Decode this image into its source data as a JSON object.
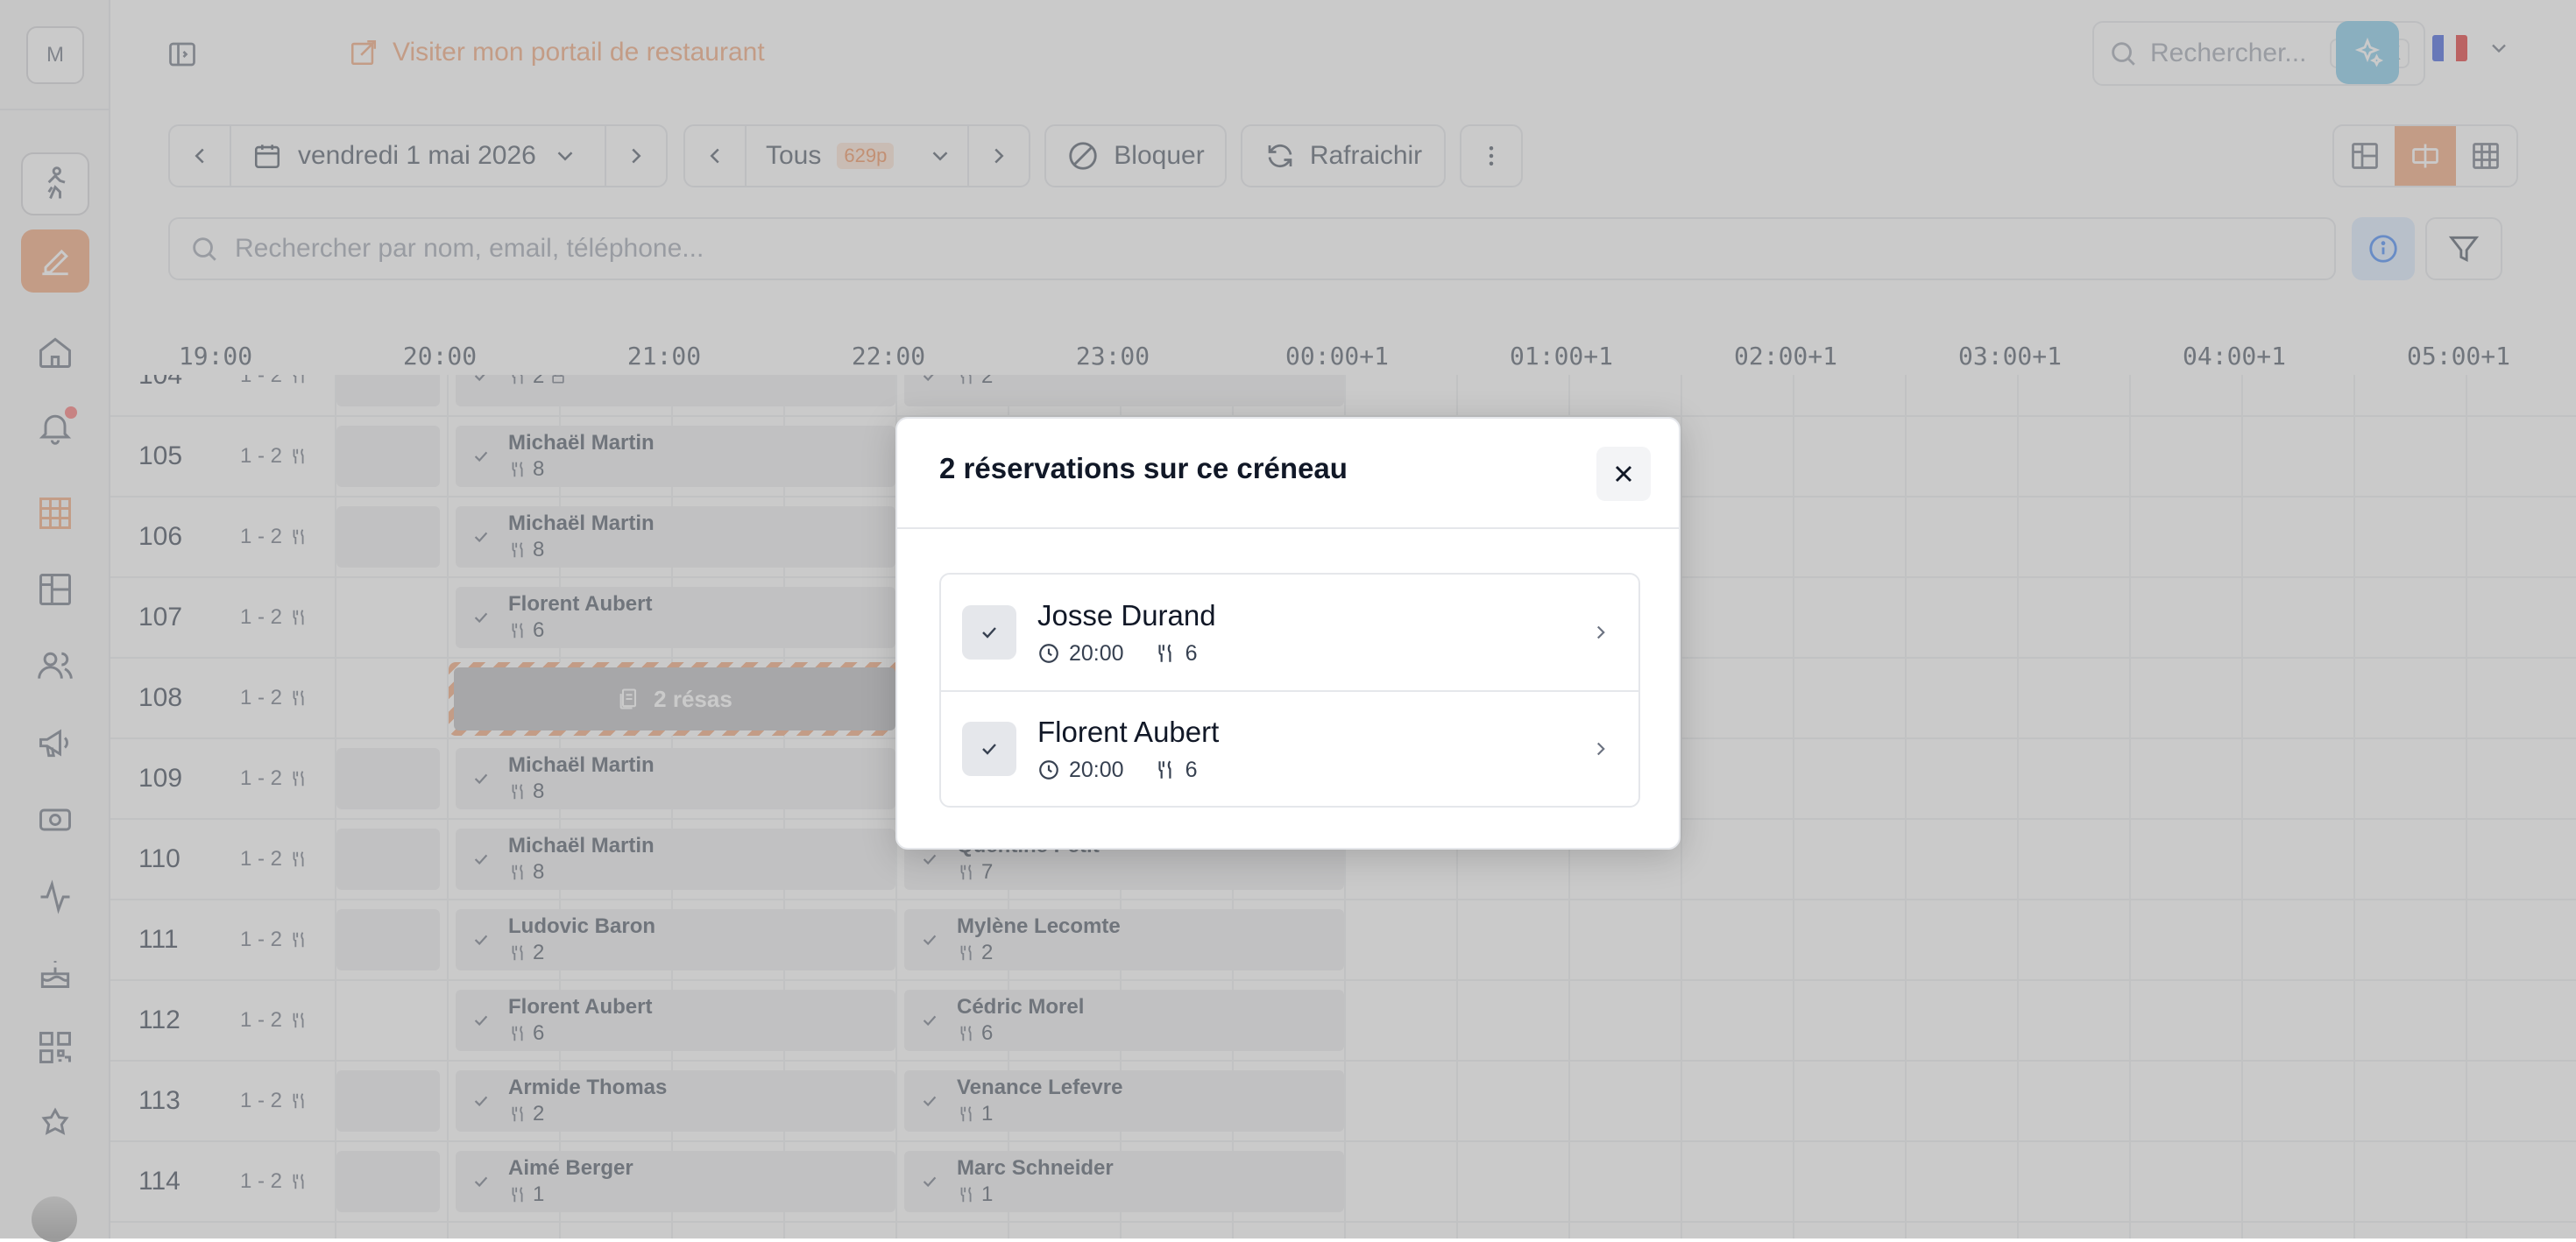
{
  "sidebar": {
    "avatar_initial": "M",
    "items": [
      {
        "icon": "walking-person-icon",
        "state": "boxed"
      },
      {
        "icon": "edit-pencil-icon",
        "state": "active"
      },
      {
        "icon": "home-icon",
        "state": "normal"
      },
      {
        "icon": "bell-icon",
        "state": "normal",
        "notification": true
      },
      {
        "icon": "grid-table-icon",
        "state": "normal"
      },
      {
        "icon": "floor-plan-icon",
        "state": "normal"
      },
      {
        "icon": "users-icon",
        "state": "normal"
      },
      {
        "icon": "megaphone-icon",
        "state": "normal"
      },
      {
        "icon": "cash-icon",
        "state": "normal"
      },
      {
        "icon": "activity-icon",
        "state": "normal"
      },
      {
        "icon": "cake-icon",
        "state": "normal"
      },
      {
        "icon": "qr-code-icon",
        "state": "normal"
      },
      {
        "icon": "sparkle-badge-icon",
        "state": "normal"
      }
    ]
  },
  "topbar": {
    "portal_link": "Visiter mon portail de restaurant",
    "search_placeholder": "Rechercher...",
    "shortcut_cmd": "⌘",
    "shortcut_key": "K",
    "language": "FR"
  },
  "toolbar": {
    "date": "vendredi 1 mai 2026",
    "filter": "Tous",
    "filter_badge": "629p",
    "block_label": "Bloquer",
    "refresh_label": "Rafraichir",
    "search_placeholder": "Rechercher par nom, email, téléphone..."
  },
  "timeline": {
    "hours": [
      "19:00",
      "20:00",
      "21:00",
      "22:00",
      "23:00",
      "00:00+1",
      "01:00+1",
      "02:00+1",
      "03:00+1",
      "04:00+1",
      "05:00+1"
    ]
  },
  "tables": [
    {
      "num": "104",
      "cap": "1 - 2",
      "resa1": {
        "name": "",
        "count": "2",
        "locked": true
      },
      "resa2": {
        "name": "",
        "count": "2"
      },
      "gap": true
    },
    {
      "num": "105",
      "cap": "1 - 2",
      "resa1": {
        "name": "Michaël Martin",
        "count": "8"
      },
      "gap": true
    },
    {
      "num": "106",
      "cap": "1 - 2",
      "resa1": {
        "name": "Michaël Martin",
        "count": "8"
      },
      "gap": true
    },
    {
      "num": "107",
      "cap": "1 - 2",
      "resa1": {
        "name": "Florent Aubert",
        "count": "6"
      },
      "gap": false
    },
    {
      "num": "108",
      "cap": "1 - 2",
      "conflict": "2 résas",
      "gap": false
    },
    {
      "num": "109",
      "cap": "1 - 2",
      "resa1": {
        "name": "Michaël Martin",
        "count": "8"
      },
      "gap": true
    },
    {
      "num": "110",
      "cap": "1 - 2",
      "resa1": {
        "name": "Michaël Martin",
        "count": "8"
      },
      "resa2": {
        "name": "Quentine Petit",
        "count": "7"
      },
      "gap": true
    },
    {
      "num": "111",
      "cap": "1 - 2",
      "resa1": {
        "name": "Ludovic Baron",
        "count": "2"
      },
      "resa2": {
        "name": "Mylène Lecomte",
        "count": "2"
      },
      "gap": true
    },
    {
      "num": "112",
      "cap": "1 - 2",
      "resa1": {
        "name": "Florent Aubert",
        "count": "6"
      },
      "resa2": {
        "name": "Cédric Morel",
        "count": "6"
      },
      "gap": false
    },
    {
      "num": "113",
      "cap": "1 - 2",
      "resa1": {
        "name": "Armide Thomas",
        "count": "2"
      },
      "resa2": {
        "name": "Venance Lefevre",
        "count": "1"
      },
      "gap": true
    },
    {
      "num": "114",
      "cap": "1 - 2",
      "resa1": {
        "name": "Aimé Berger",
        "count": "1"
      },
      "resa2": {
        "name": "Marc Schneider",
        "count": "1"
      },
      "gap": true
    }
  ],
  "modal": {
    "title": "2 réservations sur ce créneau",
    "items": [
      {
        "name": "Josse Durand",
        "time": "20:00",
        "covers": "6"
      },
      {
        "name": "Florent Aubert",
        "time": "20:00",
        "covers": "6"
      }
    ]
  },
  "colors": {
    "accent": "#f0a277",
    "ai_button": "#7fc8e8"
  }
}
